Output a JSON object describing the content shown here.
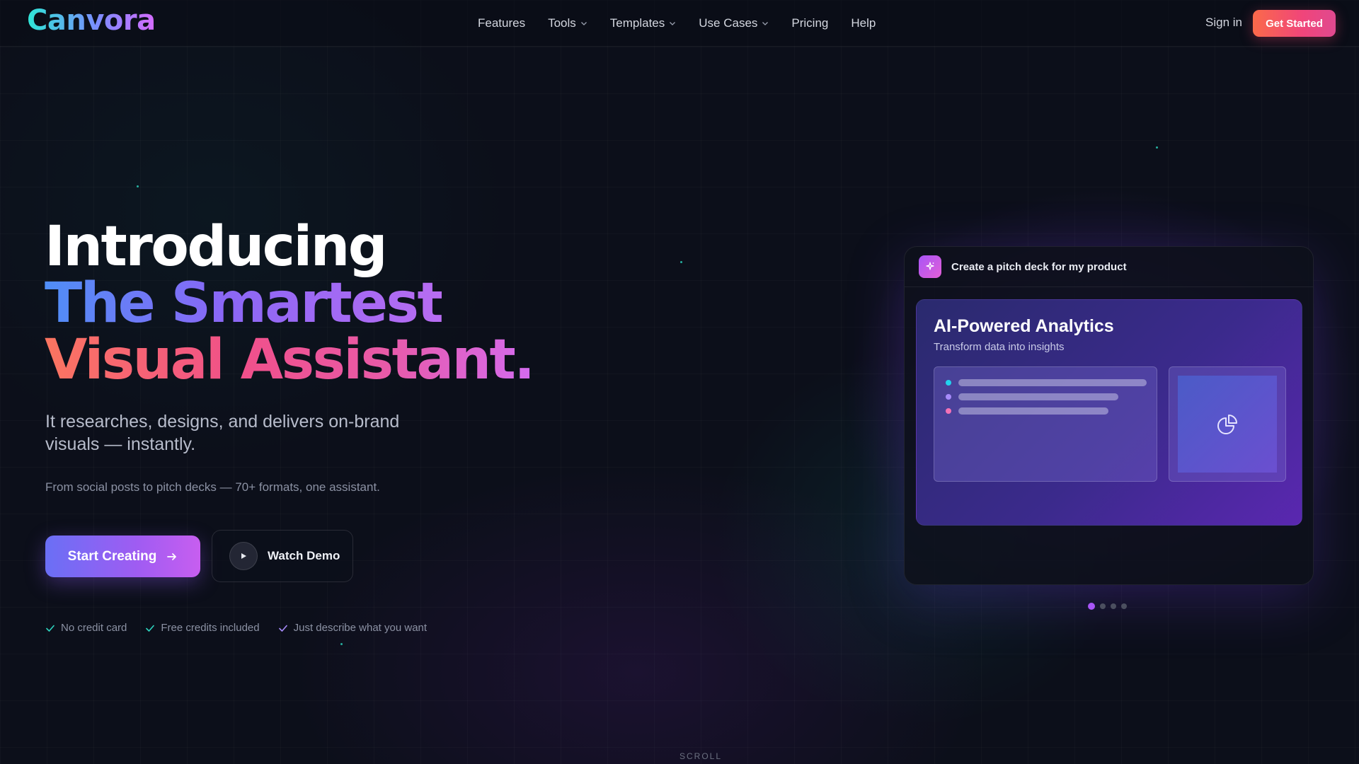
{
  "brand": {
    "logo": "Canvora"
  },
  "nav": {
    "links": [
      {
        "label": "Features",
        "has_dropdown": false
      },
      {
        "label": "Tools",
        "has_dropdown": true
      },
      {
        "label": "Templates",
        "has_dropdown": true
      },
      {
        "label": "Use Cases",
        "has_dropdown": true
      },
      {
        "label": "Pricing",
        "has_dropdown": false
      },
      {
        "label": "Help",
        "has_dropdown": false
      }
    ],
    "sign_in": "Sign in",
    "cta": "Get Started"
  },
  "hero": {
    "line1": "Introducing",
    "line2": "The Smartest",
    "line3": "Visual Assistant.",
    "subtitle": "It researches, designs, and delivers on-brand visuals — instantly.",
    "tagline": "From social posts to pitch decks — 70+ formats, one assistant.",
    "primary_button": "Start Creating",
    "secondary_button": "Watch Demo",
    "checks": [
      "No credit card",
      "Free credits included",
      "Just describe what you want"
    ]
  },
  "preview": {
    "prompt": "Create a pitch deck for my product",
    "slide_title": "AI-Powered Analytics",
    "slide_subtitle": "Transform data into insights",
    "bullet_colors": [
      "#22d3ee",
      "#a78bfa",
      "#f472b6"
    ],
    "pager_count": 4,
    "pager_active": 0
  },
  "footer": {
    "scroll_label": "SCROLL"
  },
  "colors": {
    "background": "#0c0f1a",
    "accent_purple": "#a855f7",
    "accent_coral": "#fb6a4a",
    "check_teal": "#2dd4bf",
    "check_purple": "#a78bfa"
  }
}
